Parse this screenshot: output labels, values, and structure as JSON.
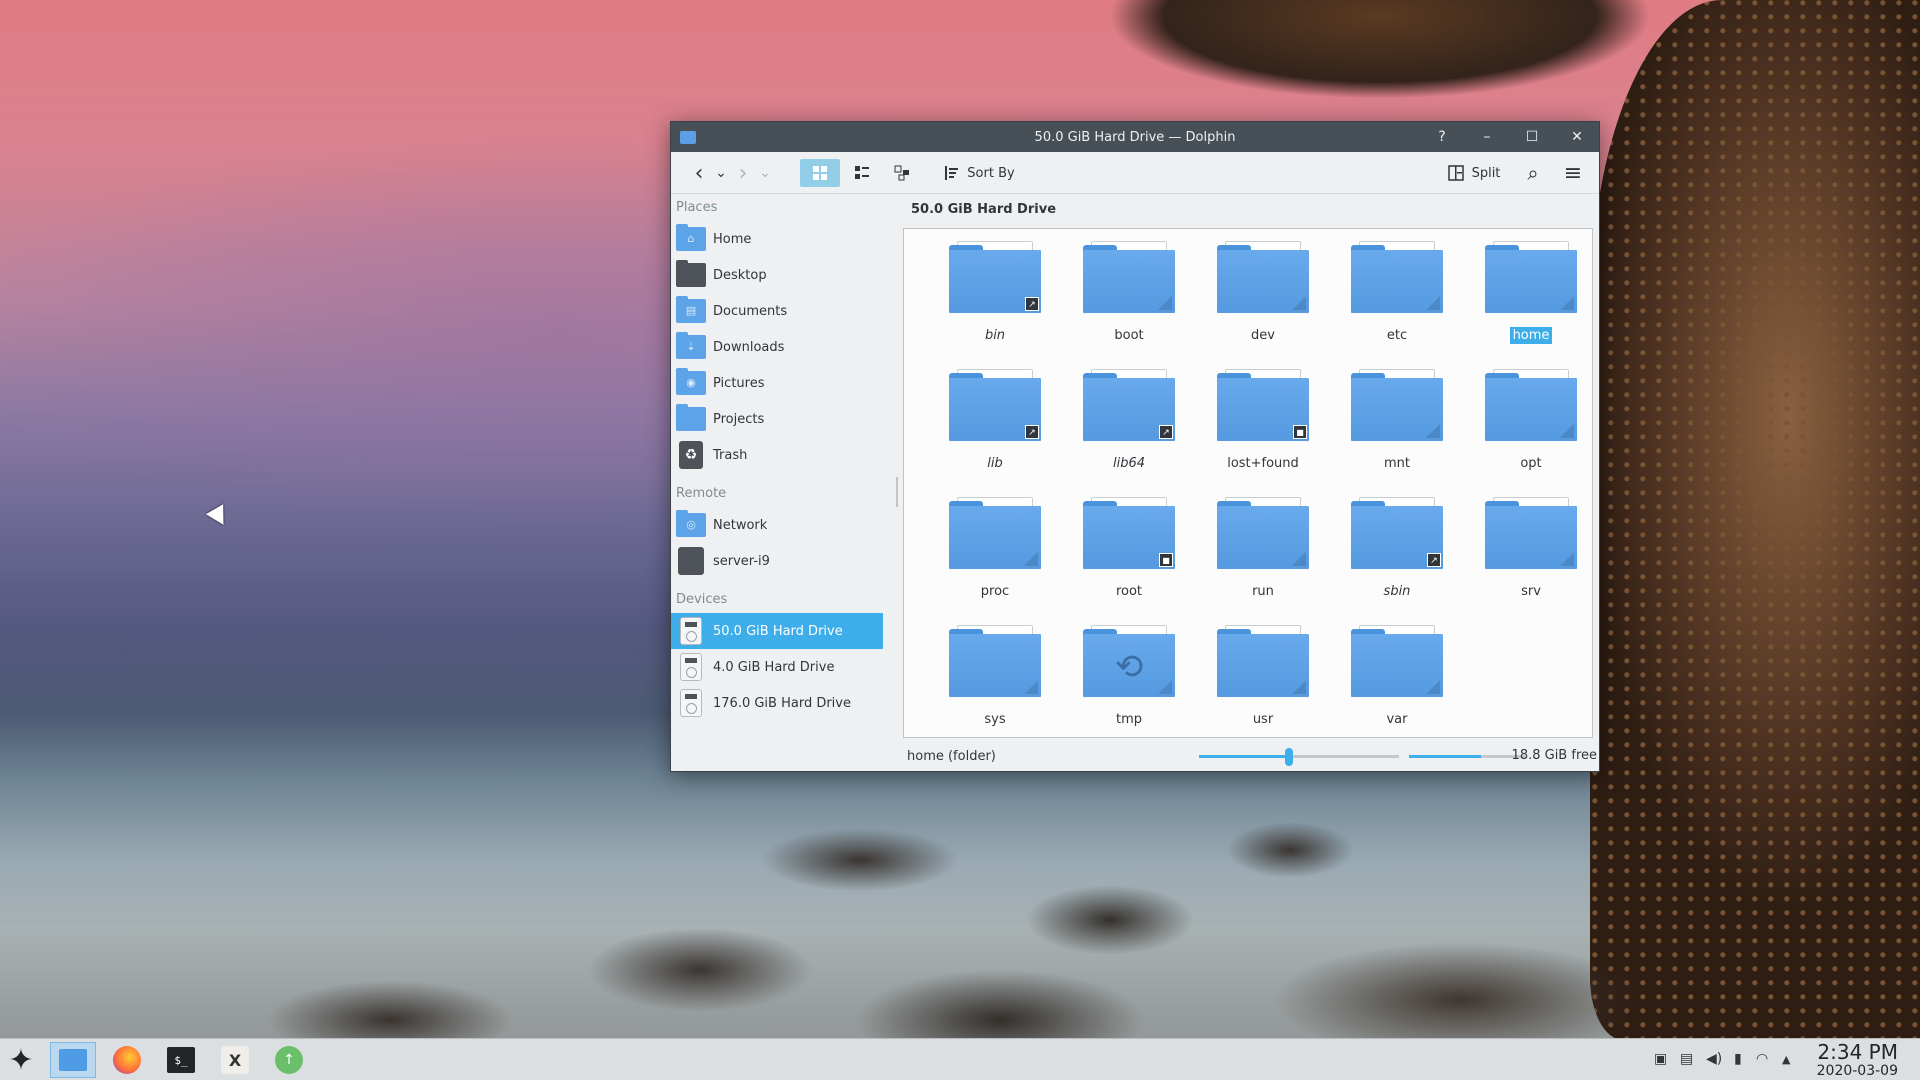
{
  "window": {
    "title": "50.0 GiB Hard Drive — Dolphin",
    "help_label": "?",
    "minimize_label": "–",
    "maximize_label": "☐",
    "close_label": "✕"
  },
  "toolbar": {
    "back_icon": "‹",
    "back_menu_icon": "⌄",
    "forward_icon": "›",
    "forward_menu_icon": "⌄",
    "sort_label": "Sort By",
    "split_label": "Split",
    "search_icon": "⌕",
    "menu_icon": "≡"
  },
  "sidebar": {
    "places_title": "Places",
    "places": [
      {
        "label": "Home",
        "glyph": "⌂"
      },
      {
        "label": "Desktop",
        "glyph": ""
      },
      {
        "label": "Documents",
        "glyph": "▤"
      },
      {
        "label": "Downloads",
        "glyph": "⇣"
      },
      {
        "label": "Pictures",
        "glyph": "◉"
      },
      {
        "label": "Projects",
        "glyph": ""
      },
      {
        "label": "Trash",
        "glyph": "♻"
      }
    ],
    "remote_title": "Remote",
    "remote": [
      {
        "label": "Network",
        "glyph": "◎"
      },
      {
        "label": "server-i9",
        "glyph": ""
      }
    ],
    "devices_title": "Devices",
    "devices": [
      {
        "label": "50.0 GiB Hard Drive"
      },
      {
        "label": "4.0 GiB Hard Drive"
      },
      {
        "label": "176.0 GiB Hard Drive"
      }
    ]
  },
  "location": {
    "title": "50.0 GiB Hard Drive"
  },
  "folders": [
    {
      "name": "bin",
      "italic": true,
      "emblem": "symlink"
    },
    {
      "name": "boot",
      "italic": false,
      "emblem": ""
    },
    {
      "name": "dev",
      "italic": false,
      "emblem": ""
    },
    {
      "name": "etc",
      "italic": false,
      "emblem": ""
    },
    {
      "name": "home",
      "italic": false,
      "emblem": "",
      "selected": true
    },
    {
      "name": "lib",
      "italic": true,
      "emblem": "symlink"
    },
    {
      "name": "lib64",
      "italic": true,
      "emblem": "symlink"
    },
    {
      "name": "lost+found",
      "italic": false,
      "emblem": "locked"
    },
    {
      "name": "mnt",
      "italic": false,
      "emblem": ""
    },
    {
      "name": "opt",
      "italic": false,
      "emblem": ""
    },
    {
      "name": "proc",
      "italic": false,
      "emblem": ""
    },
    {
      "name": "root",
      "italic": false,
      "emblem": "locked"
    },
    {
      "name": "run",
      "italic": false,
      "emblem": ""
    },
    {
      "name": "sbin",
      "italic": true,
      "emblem": "symlink"
    },
    {
      "name": "srv",
      "italic": false,
      "emblem": ""
    },
    {
      "name": "sys",
      "italic": false,
      "emblem": ""
    },
    {
      "name": "tmp",
      "italic": false,
      "emblem": "",
      "special": "temporary"
    },
    {
      "name": "usr",
      "italic": false,
      "emblem": ""
    },
    {
      "name": "var",
      "italic": false,
      "emblem": ""
    }
  ],
  "statusbar": {
    "text": "home (folder)",
    "zoom_level": 0.45,
    "space_used_fraction": 0.62,
    "free_text": "18.8 GiB free"
  },
  "taskbar": {
    "launcher_icon": "✦",
    "terminal_text": "$_",
    "xorg_text": "X",
    "updater_text": "↑",
    "tray_icons": [
      "display-icon",
      "clipboard-icon",
      "volume-icon",
      "battery-icon",
      "network-icon",
      "expand-icon"
    ],
    "time": "2:34 PM",
    "date": "2020-03-09"
  },
  "colors": {
    "accent": "#3daee9",
    "titlebar": "#475057",
    "folder": "#5da3e8"
  }
}
